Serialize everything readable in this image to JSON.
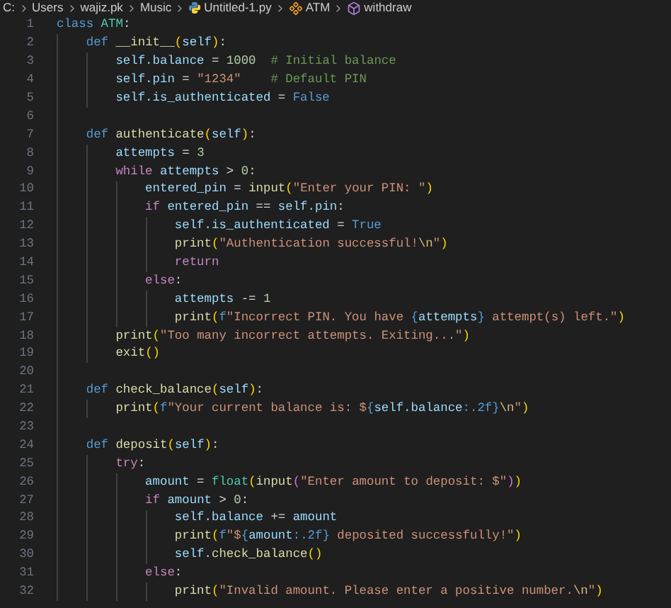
{
  "breadcrumb": [
    {
      "label": "C:",
      "kind": "folder"
    },
    {
      "label": "Users",
      "kind": "folder"
    },
    {
      "label": "wajiz.pk",
      "kind": "folder"
    },
    {
      "label": "Music",
      "kind": "folder"
    },
    {
      "label": "Untitled-1.py",
      "kind": "python-file"
    },
    {
      "label": "ATM",
      "kind": "class"
    },
    {
      "label": "withdraw",
      "kind": "method"
    }
  ],
  "editor": {
    "lines": [
      {
        "number": "1",
        "tokens": [
          {
            "text": "class",
            "kind": "kw"
          },
          {
            "text": " ATM",
            "kind": "cls"
          },
          {
            "text": ":",
            "kind": "txt"
          }
        ]
      },
      {
        "number": "2",
        "tokens": [
          {
            "text": "    def",
            "kind": "kw"
          },
          {
            "text": " __init__",
            "kind": "fn"
          },
          {
            "text": "(",
            "kind": "br1"
          },
          {
            "text": "self",
            "kind": "var"
          },
          {
            "text": ")",
            "kind": "br1"
          },
          {
            "text": ":",
            "kind": "txt"
          }
        ]
      },
      {
        "number": "3",
        "tokens": [
          {
            "text": "        self.balance",
            "kind": "var"
          },
          {
            "text": " = ",
            "kind": "txt"
          },
          {
            "text": "1000",
            "kind": "num"
          },
          {
            "text": "  # Initial balance",
            "kind": "cmt"
          }
        ]
      },
      {
        "number": "4",
        "tokens": [
          {
            "text": "        self.pin",
            "kind": "var"
          },
          {
            "text": " = ",
            "kind": "txt"
          },
          {
            "text": "\"1234\"",
            "kind": "str"
          },
          {
            "text": "    # Default PIN",
            "kind": "cmt"
          }
        ]
      },
      {
        "number": "5",
        "tokens": [
          {
            "text": "        self.is_authenticated",
            "kind": "var"
          },
          {
            "text": " = ",
            "kind": "txt"
          },
          {
            "text": "False",
            "kind": "kw"
          }
        ]
      },
      {
        "number": "6"
      },
      {
        "number": "7",
        "tokens": [
          {
            "text": "    def",
            "kind": "kw"
          },
          {
            "text": " authenticate",
            "kind": "fn"
          },
          {
            "text": "(",
            "kind": "br1"
          },
          {
            "text": "self",
            "kind": "var"
          },
          {
            "text": ")",
            "kind": "br1"
          },
          {
            "text": ":",
            "kind": "txt"
          }
        ]
      },
      {
        "number": "8",
        "tokens": [
          {
            "text": "        attempts",
            "kind": "var"
          },
          {
            "text": " = ",
            "kind": "txt"
          },
          {
            "text": "3",
            "kind": "num"
          }
        ]
      },
      {
        "number": "9",
        "tokens": [
          {
            "text": "        while",
            "kind": "ctl"
          },
          {
            "text": " attempts",
            "kind": "var"
          },
          {
            "text": " > ",
            "kind": "txt"
          },
          {
            "text": "0",
            "kind": "num"
          },
          {
            "text": ":",
            "kind": "txt"
          }
        ]
      },
      {
        "number": "10",
        "tokens": [
          {
            "text": "            entered_pin",
            "kind": "var"
          },
          {
            "text": " = ",
            "kind": "txt"
          },
          {
            "text": "input",
            "kind": "fn"
          },
          {
            "text": "(",
            "kind": "br1"
          },
          {
            "text": "\"Enter your PIN: \"",
            "kind": "str"
          },
          {
            "text": ")",
            "kind": "br1"
          }
        ]
      },
      {
        "number": "11",
        "tokens": [
          {
            "text": "            if",
            "kind": "ctl"
          },
          {
            "text": " entered_pin",
            "kind": "var"
          },
          {
            "text": " == ",
            "kind": "txt"
          },
          {
            "text": "self.pin",
            "kind": "var"
          },
          {
            "text": ":",
            "kind": "txt"
          }
        ]
      },
      {
        "number": "12",
        "tokens": [
          {
            "text": "                self.is_authenticated",
            "kind": "var"
          },
          {
            "text": " = ",
            "kind": "txt"
          },
          {
            "text": "True",
            "kind": "kw"
          }
        ]
      },
      {
        "number": "13",
        "tokens": [
          {
            "text": "                print",
            "kind": "fn"
          },
          {
            "text": "(",
            "kind": "br1"
          },
          {
            "text": "\"Authentication successful!",
            "kind": "str"
          },
          {
            "text": "\\n",
            "kind": "esc"
          },
          {
            "text": "\"",
            "kind": "str"
          },
          {
            "text": ")",
            "kind": "br1"
          }
        ]
      },
      {
        "number": "14",
        "tokens": [
          {
            "text": "                return",
            "kind": "ctl"
          }
        ]
      },
      {
        "number": "15",
        "tokens": [
          {
            "text": "            else",
            "kind": "ctl"
          },
          {
            "text": ":",
            "kind": "txt"
          }
        ]
      },
      {
        "number": "16",
        "tokens": [
          {
            "text": "                attempts",
            "kind": "var"
          },
          {
            "text": " -= ",
            "kind": "txt"
          },
          {
            "text": "1",
            "kind": "num"
          }
        ]
      },
      {
        "number": "17",
        "tokens": [
          {
            "text": "                print",
            "kind": "fn"
          },
          {
            "text": "(",
            "kind": "br1"
          },
          {
            "text": "f",
            "kind": "kw"
          },
          {
            "text": "\"Incorrect PIN. You have ",
            "kind": "str"
          },
          {
            "text": "{",
            "kind": "kw"
          },
          {
            "text": "attempts",
            "kind": "var"
          },
          {
            "text": "}",
            "kind": "kw"
          },
          {
            "text": " attempt(s) left.\"",
            "kind": "str"
          },
          {
            "text": ")",
            "kind": "br1"
          }
        ]
      },
      {
        "number": "18",
        "tokens": [
          {
            "text": "        print",
            "kind": "fn"
          },
          {
            "text": "(",
            "kind": "br1"
          },
          {
            "text": "\"Too many incorrect attempts. Exiting...\"",
            "kind": "str"
          },
          {
            "text": ")",
            "kind": "br1"
          }
        ]
      },
      {
        "number": "19",
        "tokens": [
          {
            "text": "        exit",
            "kind": "fn"
          },
          {
            "text": "()",
            "kind": "br1"
          }
        ]
      },
      {
        "number": "20"
      },
      {
        "number": "21",
        "tokens": [
          {
            "text": "    def",
            "kind": "kw"
          },
          {
            "text": " check_balance",
            "kind": "fn"
          },
          {
            "text": "(",
            "kind": "br1"
          },
          {
            "text": "self",
            "kind": "var"
          },
          {
            "text": ")",
            "kind": "br1"
          },
          {
            "text": ":",
            "kind": "txt"
          }
        ]
      },
      {
        "number": "22",
        "tokens": [
          {
            "text": "        print",
            "kind": "fn"
          },
          {
            "text": "(",
            "kind": "br1"
          },
          {
            "text": "f",
            "kind": "kw"
          },
          {
            "text": "\"Your current balance is: $",
            "kind": "str"
          },
          {
            "text": "{",
            "kind": "kw"
          },
          {
            "text": "self.balance",
            "kind": "var"
          },
          {
            "text": ":.2f}",
            "kind": "kw"
          },
          {
            "text": "\\n",
            "kind": "esc"
          },
          {
            "text": "\"",
            "kind": "str"
          },
          {
            "text": ")",
            "kind": "br1"
          }
        ]
      },
      {
        "number": "23"
      },
      {
        "number": "24",
        "tokens": [
          {
            "text": "    def",
            "kind": "kw"
          },
          {
            "text": " deposit",
            "kind": "fn"
          },
          {
            "text": "(",
            "kind": "br1"
          },
          {
            "text": "self",
            "kind": "var"
          },
          {
            "text": ")",
            "kind": "br1"
          },
          {
            "text": ":",
            "kind": "txt"
          }
        ]
      },
      {
        "number": "25",
        "tokens": [
          {
            "text": "        try",
            "kind": "ctl"
          },
          {
            "text": ":",
            "kind": "txt"
          }
        ]
      },
      {
        "number": "26",
        "tokens": [
          {
            "text": "            amount",
            "kind": "var"
          },
          {
            "text": " = ",
            "kind": "txt"
          },
          {
            "text": "float",
            "kind": "cls"
          },
          {
            "text": "(",
            "kind": "br1"
          },
          {
            "text": "input",
            "kind": "fn"
          },
          {
            "text": "(",
            "kind": "br2"
          },
          {
            "text": "\"Enter amount to deposit: $\"",
            "kind": "str"
          },
          {
            "text": ")",
            "kind": "br2"
          },
          {
            "text": ")",
            "kind": "br1"
          }
        ]
      },
      {
        "number": "27",
        "tokens": [
          {
            "text": "            if",
            "kind": "ctl"
          },
          {
            "text": " amount",
            "kind": "var"
          },
          {
            "text": " > ",
            "kind": "txt"
          },
          {
            "text": "0",
            "kind": "num"
          },
          {
            "text": ":",
            "kind": "txt"
          }
        ]
      },
      {
        "number": "28",
        "tokens": [
          {
            "text": "                self.balance",
            "kind": "var"
          },
          {
            "text": " += ",
            "kind": "txt"
          },
          {
            "text": "amount",
            "kind": "var"
          }
        ]
      },
      {
        "number": "29",
        "tokens": [
          {
            "text": "                print",
            "kind": "fn"
          },
          {
            "text": "(",
            "kind": "br1"
          },
          {
            "text": "f",
            "kind": "kw"
          },
          {
            "text": "\"$",
            "kind": "str"
          },
          {
            "text": "{",
            "kind": "kw"
          },
          {
            "text": "amount",
            "kind": "var"
          },
          {
            "text": ":.2f}",
            "kind": "kw"
          },
          {
            "text": " deposited successfully!\"",
            "kind": "str"
          },
          {
            "text": ")",
            "kind": "br1"
          }
        ]
      },
      {
        "number": "30",
        "tokens": [
          {
            "text": "                self.",
            "kind": "var"
          },
          {
            "text": "check_balance",
            "kind": "fn"
          },
          {
            "text": "()",
            "kind": "br1"
          }
        ]
      },
      {
        "number": "31",
        "tokens": [
          {
            "text": "            else",
            "kind": "ctl"
          },
          {
            "text": ":",
            "kind": "txt"
          }
        ]
      },
      {
        "number": "32",
        "tokens": [
          {
            "text": "                print",
            "kind": "fn"
          },
          {
            "text": "(",
            "kind": "br1"
          },
          {
            "text": "\"Invalid amount. Please enter a positive number.",
            "kind": "str"
          },
          {
            "text": "\\n",
            "kind": "esc"
          },
          {
            "text": "\"",
            "kind": "str"
          },
          {
            "text": ")",
            "kind": "br1"
          }
        ]
      }
    ]
  }
}
